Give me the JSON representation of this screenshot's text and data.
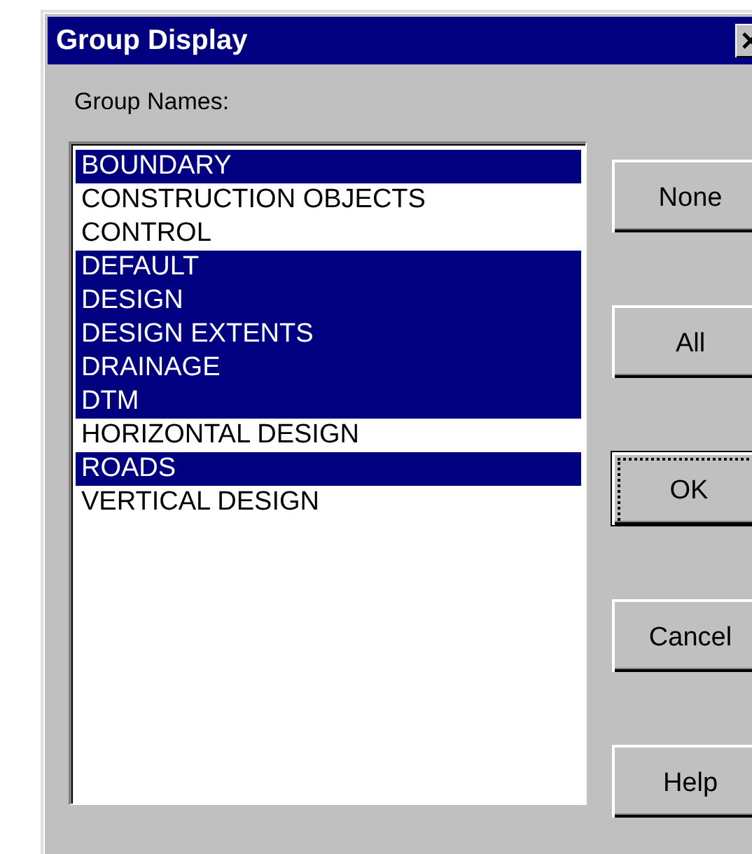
{
  "window": {
    "title": "Group Display"
  },
  "list_label": "Group Names:",
  "groups": [
    {
      "name": "BOUNDARY",
      "selected": true
    },
    {
      "name": "CONSTRUCTION OBJECTS",
      "selected": false
    },
    {
      "name": "CONTROL",
      "selected": false
    },
    {
      "name": "DEFAULT",
      "selected": true
    },
    {
      "name": "DESIGN",
      "selected": true
    },
    {
      "name": "DESIGN EXTENTS",
      "selected": true
    },
    {
      "name": "DRAINAGE",
      "selected": true
    },
    {
      "name": "DTM",
      "selected": true
    },
    {
      "name": "HORIZONTAL DESIGN",
      "selected": false
    },
    {
      "name": "ROADS",
      "selected": true
    },
    {
      "name": "VERTICAL DESIGN",
      "selected": false
    }
  ],
  "buttons": [
    {
      "label": "None",
      "default": false
    },
    {
      "label": "All",
      "default": false
    },
    {
      "label": "OK",
      "default": true
    },
    {
      "label": "Cancel",
      "default": false
    },
    {
      "label": "Help",
      "default": false
    }
  ]
}
